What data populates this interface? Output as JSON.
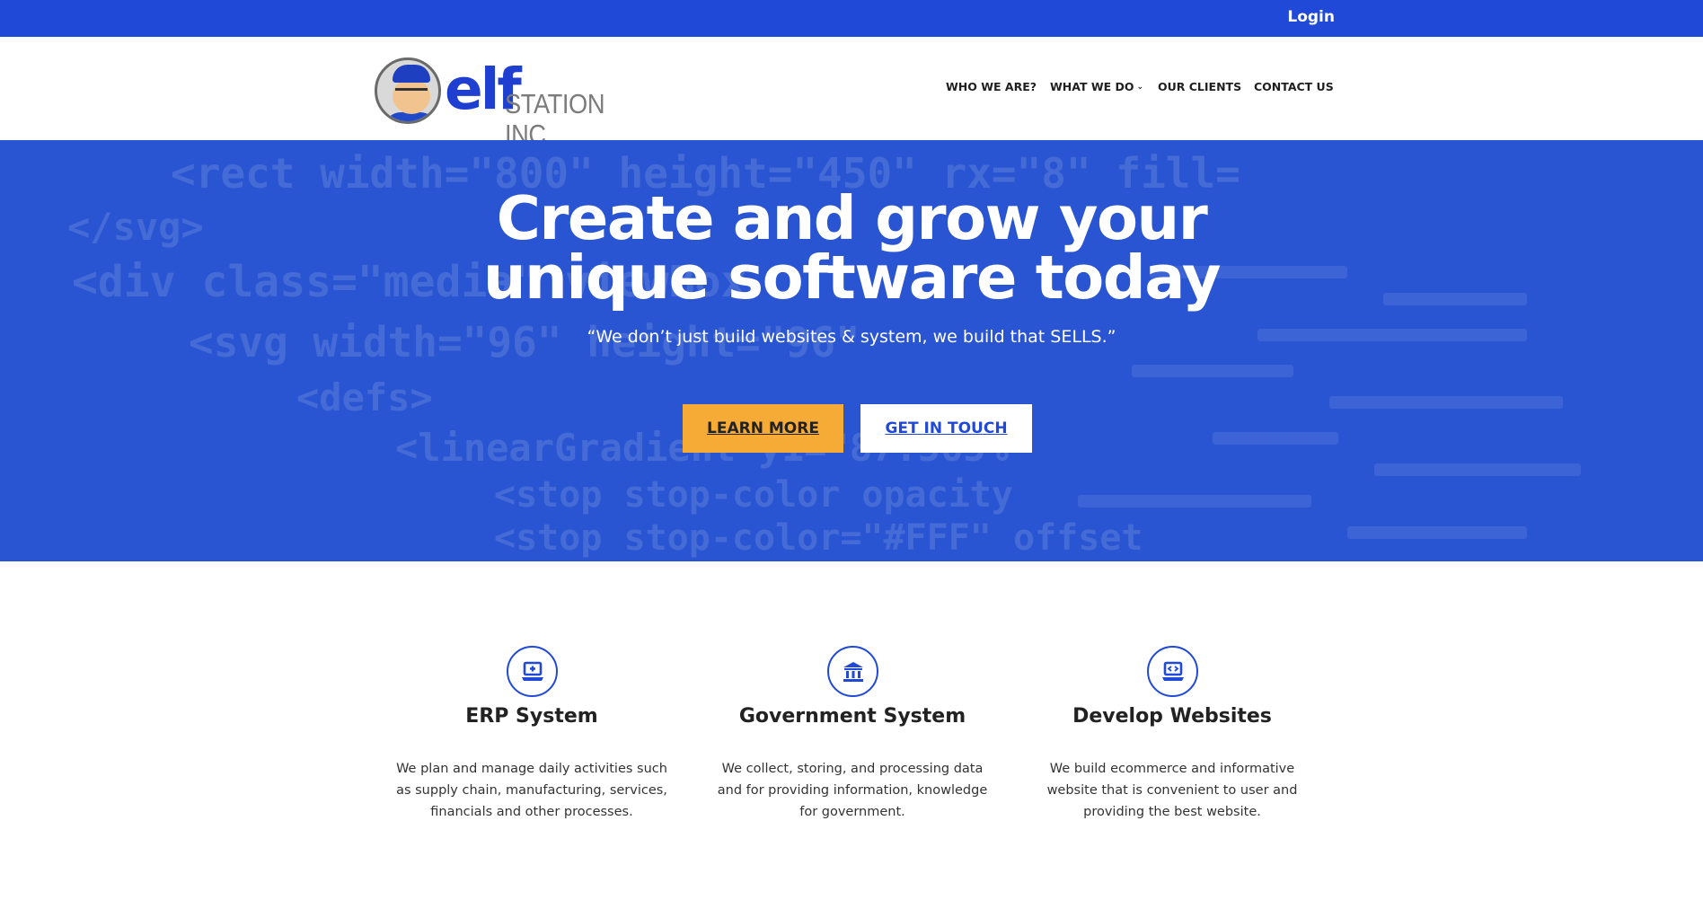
{
  "topbar": {
    "login_label": "Login"
  },
  "brand": {
    "name": "elf",
    "suffix": "STATION INC."
  },
  "nav": {
    "items": [
      {
        "label": "WHO WE ARE?"
      },
      {
        "label": "WHAT WE DO",
        "has_dropdown": true
      },
      {
        "label": "OUR CLIENTS"
      },
      {
        "label": "CONTACT US"
      }
    ]
  },
  "hero": {
    "title_line1": "Create and grow your",
    "title_line2": "unique software today",
    "tagline": "“We don’t just build websites & system, we build that SELLS.”",
    "primary_button": "LEARN MORE",
    "secondary_button": "GET IN TOUCH"
  },
  "services": [
    {
      "icon": "laptop-plus-icon",
      "title": "ERP System",
      "description": "We plan and manage daily activities such as supply chain, manufacturing, services, financials and other processes."
    },
    {
      "icon": "government-building-icon",
      "title": "Government System",
      "description": "We collect, storing, and processing data and for providing information, knowledge for government."
    },
    {
      "icon": "laptop-code-icon",
      "title": "Develop Websites",
      "description": "We build ecommerce and informative website that is convenient to user and providing the best website."
    }
  ],
  "colors": {
    "primary_blue": "#2149d8",
    "hero_blue": "#2a55d2",
    "accent_orange": "#f7ab37",
    "white": "#ffffff",
    "text_dark": "#222222"
  }
}
